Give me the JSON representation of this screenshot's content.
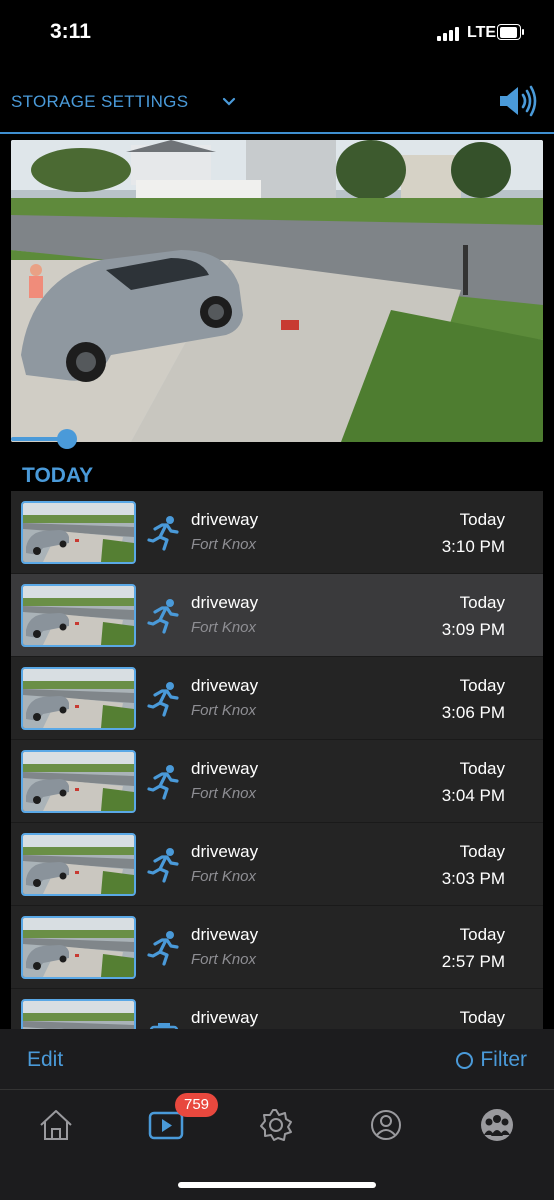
{
  "status_bar": {
    "time": "3:11",
    "network": "LTE"
  },
  "header": {
    "storage_label": "STORAGE SETTINGS",
    "icons": [
      "chevron-down-icon",
      "speaker-icon"
    ]
  },
  "player": {
    "progress": 0.1
  },
  "section": {
    "title": "TODAY"
  },
  "events": [
    {
      "title": "driveway",
      "location": "Fort Knox",
      "day": "Today",
      "time": "3:10 PM",
      "icon": "motion-icon"
    },
    {
      "title": "driveway",
      "location": "Fort Knox",
      "day": "Today",
      "time": "3:09 PM",
      "icon": "motion-icon"
    },
    {
      "title": "driveway",
      "location": "Fort Knox",
      "day": "Today",
      "time": "3:06 PM",
      "icon": "motion-icon"
    },
    {
      "title": "driveway",
      "location": "Fort Knox",
      "day": "Today",
      "time": "3:04 PM",
      "icon": "motion-icon"
    },
    {
      "title": "driveway",
      "location": "Fort Knox",
      "day": "Today",
      "time": "3:03 PM",
      "icon": "motion-icon"
    },
    {
      "title": "driveway",
      "location": "Fort Knox",
      "day": "Today",
      "time": "2:57 PM",
      "icon": "motion-icon"
    },
    {
      "title": "driveway",
      "location": "",
      "day": "Today",
      "time": "",
      "icon": "camera-icon"
    }
  ],
  "toolbar": {
    "edit_label": "Edit",
    "filter_label": "Filter"
  },
  "tabbar": {
    "badge": "759",
    "tabs": [
      "home-icon",
      "video-library-icon",
      "settings-icon",
      "account-icon",
      "community-icon"
    ]
  },
  "colors": {
    "accent": "#4a9ad9",
    "badge": "#e8483e",
    "row_bg": "#242424",
    "selected_row_bg": "#3a3a3c"
  }
}
